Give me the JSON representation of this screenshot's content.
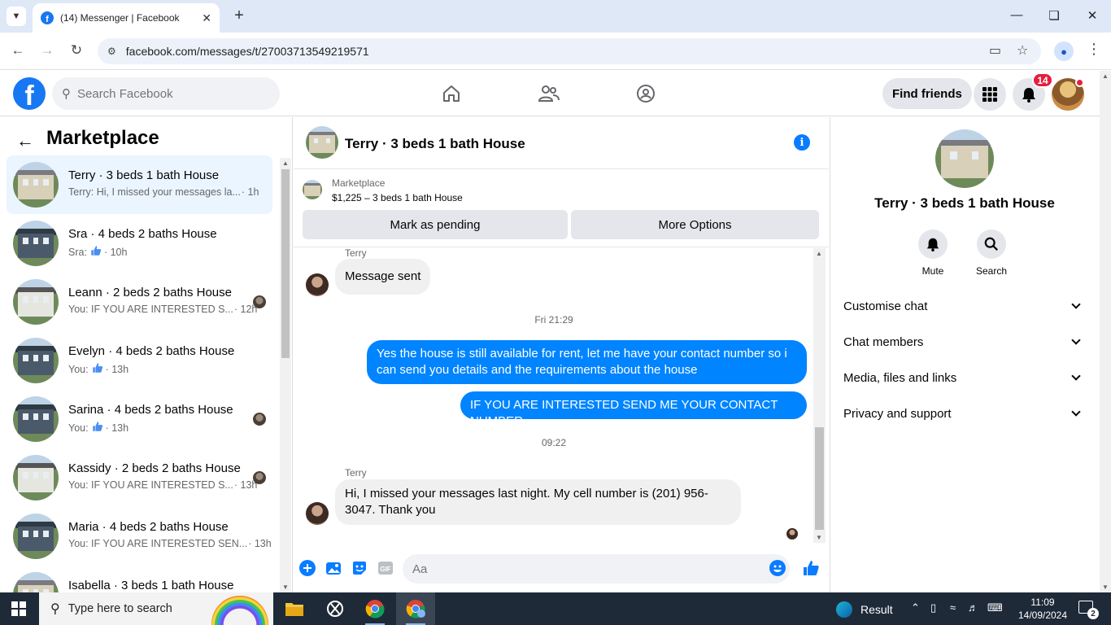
{
  "browser": {
    "tab_title": "(14) Messenger | Facebook",
    "url": "facebook.com/messages/t/27003713549219571"
  },
  "header": {
    "search_placeholder": "Search Facebook",
    "find_friends": "Find friends",
    "notification_count": "14"
  },
  "sidebar": {
    "title": "Marketplace",
    "conversations": [
      {
        "name": "Terry · 3 beds 1 bath House",
        "preview": "Terry: Hi, I missed your messages la...",
        "time": "· 1h",
        "active": true
      },
      {
        "name": "Sra · 4 beds 2 baths House",
        "preview": "Sra:",
        "time": "· 10h",
        "like": true
      },
      {
        "name": "Leann · 2 beds 2 baths House",
        "preview": "You: IF YOU ARE INTERESTED S...",
        "time": "· 12h",
        "seen": true
      },
      {
        "name": "Evelyn · 4 beds 2 baths House",
        "preview": "You:",
        "time": "· 13h",
        "like": true
      },
      {
        "name": "Sarina · 4 beds 2 baths House",
        "preview": "You:",
        "time": "· 13h",
        "like": true,
        "seen": true
      },
      {
        "name": "Kassidy · 2 beds 2 baths House",
        "preview": "You: IF YOU ARE INTERESTED S...",
        "time": "· 13h",
        "seen": true
      },
      {
        "name": "Maria · 4 beds 2 baths House",
        "preview": "You: IF YOU ARE INTERESTED SEN...",
        "time": "· 13h"
      },
      {
        "name": "Isabella · 3 beds 1 bath House",
        "preview": "",
        "time": ""
      }
    ]
  },
  "chat": {
    "title": "Terry · 3 beds 1 bath House",
    "marketplace_label": "Marketplace",
    "listing": "$1,225 – 3 beds 1 bath House",
    "mark_pending": "Mark as pending",
    "more_options": "More Options",
    "sender_1": "Terry",
    "msg_1": "Message sent",
    "time_1": "Fri 21:29",
    "out_1": "Yes the house is still available for rent, let me have your contact number so i can send you details and the requirements about the house",
    "out_2": "IF YOU ARE INTERESTED SEND ME YOUR CONTACT NUMBER",
    "time_2": "09:22",
    "sender_2": "Terry",
    "msg_2": "Hi, I missed your messages last night. My cell number is (201) 956-3047. Thank you",
    "composer_placeholder": "Aa"
  },
  "details": {
    "name": "Terry · 3 beds 1 bath House",
    "mute": "Mute",
    "search": "Search",
    "sections": [
      "Customise chat",
      "Chat members",
      "Media, files and links",
      "Privacy and support"
    ]
  },
  "taskbar": {
    "search_placeholder": "Type here to search",
    "result": "Result",
    "time": "11:09",
    "date": "14/09/2024",
    "notif_count": "2"
  },
  "colors": {
    "accent": "#1877f2",
    "outgoing_bubble": "#0084ff",
    "badge": "#e41e3f"
  }
}
